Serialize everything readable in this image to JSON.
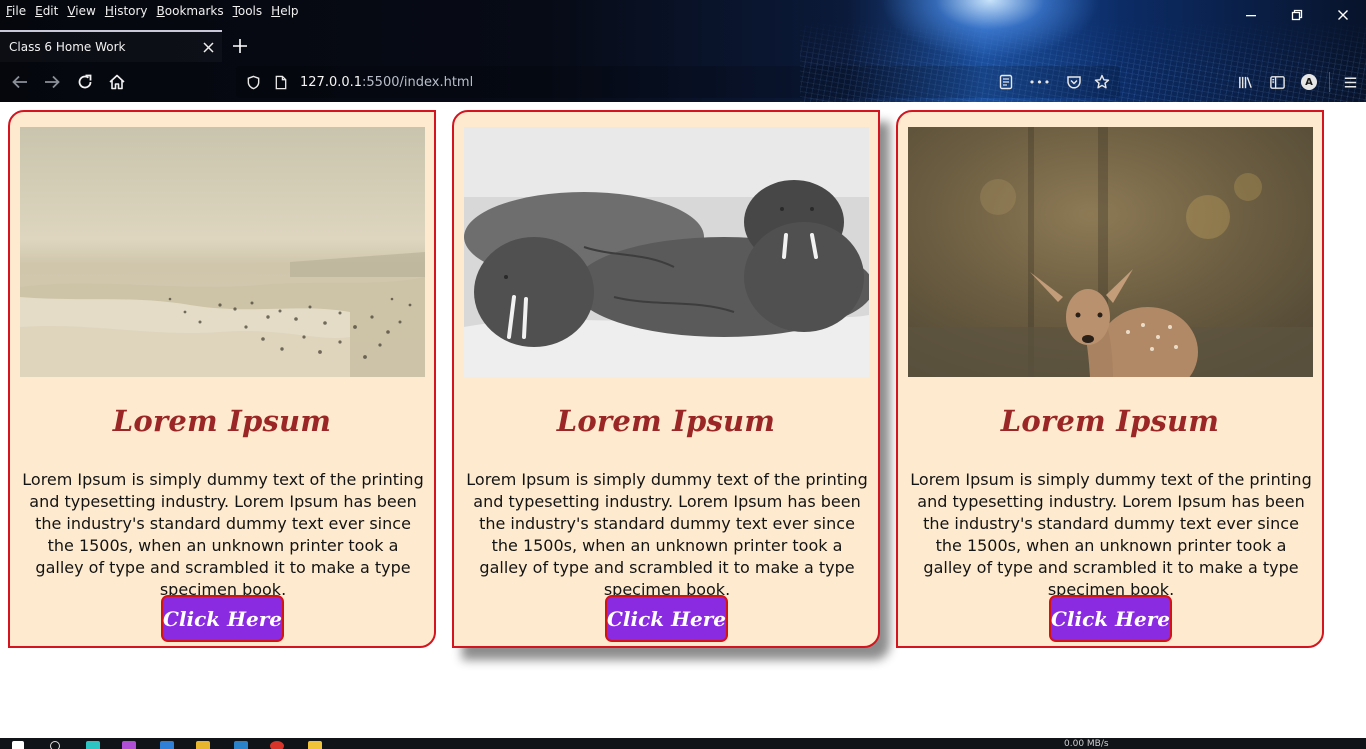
{
  "browser": {
    "menu": [
      "File",
      "Edit",
      "View",
      "History",
      "Bookmarks",
      "Tools",
      "Help"
    ],
    "window_controls": {
      "minimize": "–",
      "restore": "❐",
      "close": "✕"
    },
    "tab": {
      "title": "Class 6 Home Work",
      "close": "✕"
    },
    "new_tab": "+",
    "url": {
      "host": "127.0.0.1",
      "rest": ":5500/index.html"
    },
    "icons": {
      "back": "back-arrow-icon",
      "forward": "forward-arrow-icon",
      "reload": "reload-icon",
      "home": "home-icon",
      "tracking": "shield-icon",
      "page": "page-icon",
      "reader": "reader-view-icon",
      "more": "more-dots-icon",
      "pocket": "pocket-icon",
      "bookmark": "star-icon",
      "library": "library-icon",
      "sidebar": "sidebar-icon",
      "account": "account-avatar-icon",
      "menu": "hamburger-menu-icon"
    },
    "more_glyph": "•••",
    "account_letter": "A",
    "accent": "#c9c9d9"
  },
  "cards": [
    {
      "image": "beach-photo",
      "title": "Lorem Ipsum",
      "text": "Lorem Ipsum is simply dummy text of the printing and typesetting industry. Lorem Ipsum has been the industry's standard dummy text ever since the 1500s, when an unknown printer took a galley of type and scrambled it to make a type specimen book.",
      "button": "Click Here"
    },
    {
      "image": "walrus-photo",
      "title": "Lorem Ipsum",
      "text": "Lorem Ipsum is simply dummy text of the printing and typesetting industry. Lorem Ipsum has been the industry's standard dummy text ever since the 1500s, when an unknown printer took a galley of type and scrambled it to make a type specimen book.",
      "button": "Click Here"
    },
    {
      "image": "deer-photo",
      "title": "Lorem Ipsum",
      "text": "Lorem Ipsum is simply dummy text of the printing and typesetting industry. Lorem Ipsum has been the industry's standard dummy text ever since the 1500s, when an unknown printer took a galley of type and scrambled it to make a type specimen book.",
      "button": "Click Here"
    }
  ],
  "colors": {
    "card_bg": "#feebcf",
    "card_border": "#d4141f",
    "title": "#9b2626",
    "button_bg": "#8a2be2",
    "button_border": "#d41414"
  },
  "taskbar": {
    "network": "0.00 MB/s"
  }
}
